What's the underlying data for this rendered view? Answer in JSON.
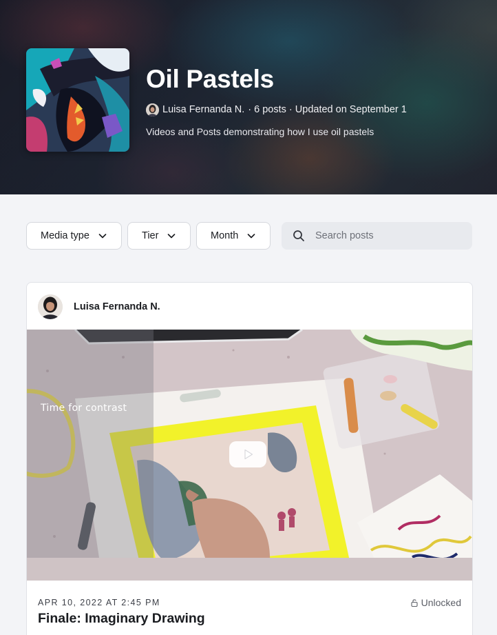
{
  "collection": {
    "title": "Oil Pastels",
    "creator_name": "Luisa Fernanda N.",
    "meta_details": " · 6 posts · Updated on September 1",
    "description": "Videos and Posts demonstrating how I use oil pastels"
  },
  "filters": {
    "media_type_label": "Media type",
    "tier_label": "Tier",
    "month_label": "Month",
    "search_placeholder": "Search posts"
  },
  "post": {
    "author_name": "Luisa Fernanda N.",
    "video_caption": "Time for contrast",
    "date": "APR 10, 2022 AT 2:45 PM",
    "access_status": "Unlocked",
    "title": "Finale: Imaginary Drawing"
  },
  "icons": {
    "filter_dropdown": "chevron-down-icon",
    "search": "search-icon",
    "play": "play-icon",
    "access": "unlock-icon"
  },
  "colors": {
    "page_background": "#f3f4f7",
    "card_background": "#ffffff",
    "hero_text": "#ffffff",
    "tape_yellow": "#f2f22a"
  }
}
